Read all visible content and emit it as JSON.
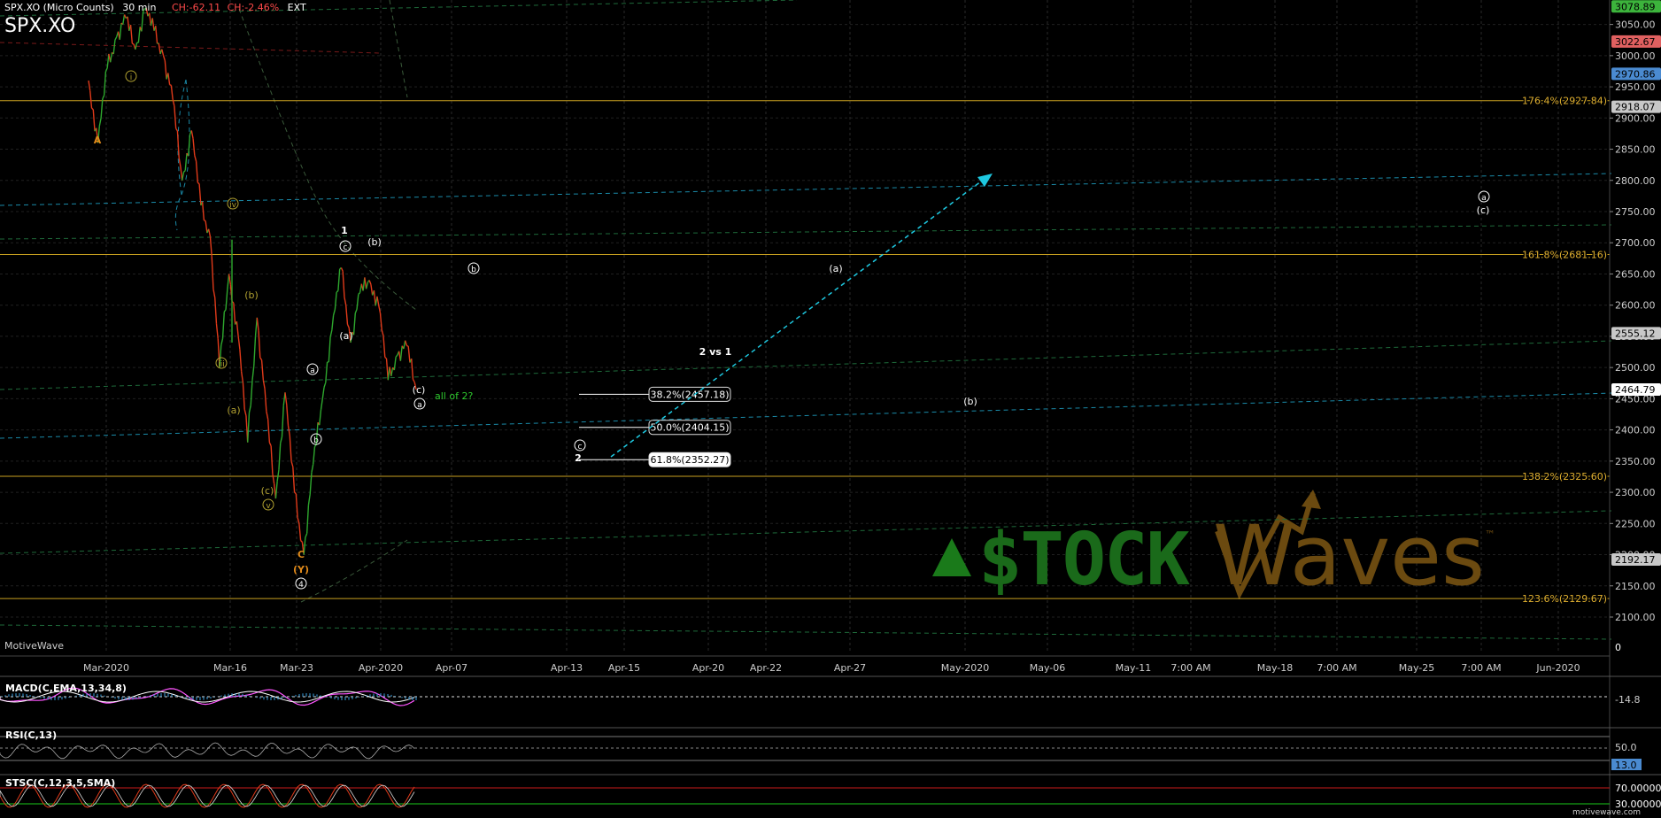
{
  "header": {
    "symbol_desc": "SPX.XO (Micro Counts)",
    "timeframe": "30 min",
    "change_points": "CH:-62.11",
    "change_percent": "CH:-2.46%",
    "session": "EXT",
    "symbol": "SPX.XO"
  },
  "branding": {
    "platform": "MotiveWave",
    "watermark_left": "$TOCK",
    "watermark_right": "Waves",
    "trademark": "™",
    "footer_url": "motivewave.com"
  },
  "colors": {
    "background": "#000000",
    "fib_line": "#c8a020",
    "fib_label": "#e0b030",
    "projection_arrow": "#1ec8e0",
    "price_up": "#2ea82e",
    "price_down": "#e03a1a",
    "wave_white": "#ffffff",
    "wave_olive": "#b0a030",
    "wave_orange": "#e08a1a",
    "watermark_green": "#1a7a1a",
    "watermark_brown": "#6b4a10",
    "macd_line": "#ff55ff",
    "macd_hist": "#3aa0e0"
  },
  "chart_data": {
    "type": "line",
    "title": "SPX.XO (Micro Counts)",
    "timeframe": "30 min",
    "y_axis": {
      "min": 2100,
      "max": 3078.89,
      "ticks": [
        3050.0,
        3000.0,
        2950.0,
        2900.0,
        2850.0,
        2800.0,
        2750.0,
        2700.0,
        2650.0,
        2600.0,
        2550.0,
        2500.0,
        2450.0,
        2400.0,
        2350.0,
        2300.0,
        2250.0,
        2200.0,
        2150.0,
        2100.0
      ],
      "tick_labels": [
        "3050.00",
        "3000.00",
        "2950.00",
        "2900.00",
        "2850.00",
        "2800.00",
        "2750.00",
        "2700.00",
        "2650.00",
        "2600.00",
        "2550.00",
        "2500.00",
        "2450.00",
        "2400.00",
        "2350.00",
        "2300.00",
        "2250.00",
        "2200.00",
        "2150.00",
        "2100.00"
      ],
      "zero_label": "0"
    },
    "price_tags": [
      {
        "label": "3078.89",
        "value": 3078.89,
        "color": "#3cb43c"
      },
      {
        "label": "3022.67",
        "value": 3022.67,
        "color": "#e06060"
      },
      {
        "label": "2970.86",
        "value": 2970.86,
        "color": "#4a8ad0"
      },
      {
        "label": "2918.07",
        "value": 2918.07,
        "color": "#c8c8c8"
      },
      {
        "label": "2555.12",
        "value": 2555.12,
        "color": "#c8c8c8"
      },
      {
        "label": "2464.79",
        "value": 2464.79,
        "color": "#ffffff"
      },
      {
        "label": "2192.17",
        "value": 2192.17,
        "color": "#c8c8c8"
      }
    ],
    "x_axis": {
      "tick_labels": [
        "Mar-2020",
        "Mar-16",
        "Mar-23",
        "Apr-2020",
        "Apr-07",
        "Apr-13",
        "Apr-15",
        "Apr-20",
        "Apr-22",
        "Apr-27",
        "May-2020",
        "May-06",
        "May-11",
        "7:00 AM",
        "May-18",
        "7:00 AM",
        "May-25",
        "7:00 AM",
        "Jun-2020"
      ]
    },
    "fib_levels": [
      {
        "label": "176.4%(2927.84)",
        "value": 2927.84
      },
      {
        "label": "161.8%(2681.16)",
        "value": 2681.16
      },
      {
        "label": "138.2%(2325.60)",
        "value": 2325.6
      },
      {
        "label": "123.6%(2129.67)",
        "value": 2129.67
      }
    ],
    "retracement": {
      "title": "2 vs 1",
      "levels": [
        {
          "label": "38.2%(2457.18)",
          "value": 2457.18
        },
        {
          "label": "50.0%(2404.15)",
          "value": 2404.15
        },
        {
          "label": "61.8%(2352.27)",
          "value": 2352.27
        }
      ]
    },
    "note": "all of 2?",
    "price_path": [
      {
        "t": "Feb-25",
        "v": 2960
      },
      {
        "t": "Feb-26",
        "v": 2860
      },
      {
        "t": "Feb-27",
        "v": 2980
      },
      {
        "t": "Feb-28",
        "v": 3030
      },
      {
        "t": "Mar-02",
        "v": 3060
      },
      {
        "t": "Mar-03",
        "v": 3010
      },
      {
        "t": "Mar-04",
        "v": 3075
      },
      {
        "t": "Mar-05",
        "v": 3040
      },
      {
        "t": "Mar-06",
        "v": 3000
      },
      {
        "t": "Mar-09",
        "v": 2930
      },
      {
        "t": "Mar-10",
        "v": 2800
      },
      {
        "t": "Mar-11",
        "v": 2880
      },
      {
        "t": "Mar-12",
        "v": 2760
      },
      {
        "t": "Mar-13",
        "v": 2710
      },
      {
        "t": "Mar-16",
        "v": 2500
      },
      {
        "t": "Mar-16b",
        "v": 2650
      },
      {
        "t": "Mar-17",
        "v": 2550
      },
      {
        "t": "Mar-18",
        "v": 2380
      },
      {
        "t": "Mar-18b",
        "v": 2580
      },
      {
        "t": "Mar-19",
        "v": 2430
      },
      {
        "t": "Mar-20",
        "v": 2290
      },
      {
        "t": "Mar-20b",
        "v": 2460
      },
      {
        "t": "Mar-23",
        "v": 2300
      },
      {
        "t": "Mar-23b",
        "v": 2200
      },
      {
        "t": "Mar-24",
        "v": 2345
      },
      {
        "t": "Mar-25",
        "v": 2450
      },
      {
        "t": "Mar-26",
        "v": 2560
      },
      {
        "t": "Mar-26b",
        "v": 2660
      },
      {
        "t": "Mar-27",
        "v": 2540
      },
      {
        "t": "Mar-30",
        "v": 2620
      },
      {
        "t": "Mar-31",
        "v": 2640
      },
      {
        "t": "Apr-01",
        "v": 2600
      },
      {
        "t": "Apr-01b",
        "v": 2480
      },
      {
        "t": "Apr-02",
        "v": 2520
      },
      {
        "t": "Apr-02b",
        "v": 2535
      },
      {
        "t": "Apr-03",
        "v": 2464.79
      }
    ],
    "wave_labels": [
      {
        "text": "A",
        "color": "orange"
      },
      {
        "text": "C",
        "color": "orange"
      },
      {
        "text": "(Y)",
        "color": "orange"
      },
      {
        "text": "4",
        "color": "white-circled"
      },
      {
        "text": "i",
        "color": "olive-circled"
      },
      {
        "text": "iv",
        "color": "olive-circled"
      },
      {
        "text": "iii",
        "color": "olive-circled"
      },
      {
        "text": "v",
        "color": "olive-circled"
      },
      {
        "text": "(b)",
        "color": "olive"
      },
      {
        "text": "(a)",
        "color": "olive"
      },
      {
        "text": "(c)",
        "color": "olive"
      },
      {
        "text": "1",
        "color": "white"
      },
      {
        "text": "c",
        "color": "white-circled"
      },
      {
        "text": "(b)",
        "color": "white"
      },
      {
        "text": "(a)",
        "color": "white"
      },
      {
        "text": "a",
        "color": "white-circled"
      },
      {
        "text": "b",
        "color": "white-circled"
      },
      {
        "text": "(c)",
        "color": "white"
      },
      {
        "text": "a",
        "color": "white-circled"
      },
      {
        "text": "b",
        "color": "white-circled"
      },
      {
        "text": "c",
        "color": "white-circled"
      },
      {
        "text": "2",
        "color": "white"
      },
      {
        "text": "(a)",
        "color": "white"
      },
      {
        "text": "(b)",
        "color": "white"
      },
      {
        "text": "a",
        "color": "white-circled"
      },
      {
        "text": "(c)",
        "color": "white"
      }
    ]
  },
  "indicators": {
    "macd": {
      "label": "MACD(C,EMA,13,34,8)",
      "value_label": "-14.8"
    },
    "rsi": {
      "label": "RSI(C,13)",
      "level_label": "50.0",
      "value_label": "13.0"
    },
    "stoch": {
      "label": "STSC(C,12,3,5,SMA)",
      "upper_label": "70.00000",
      "lower_label": "30.00000"
    }
  }
}
